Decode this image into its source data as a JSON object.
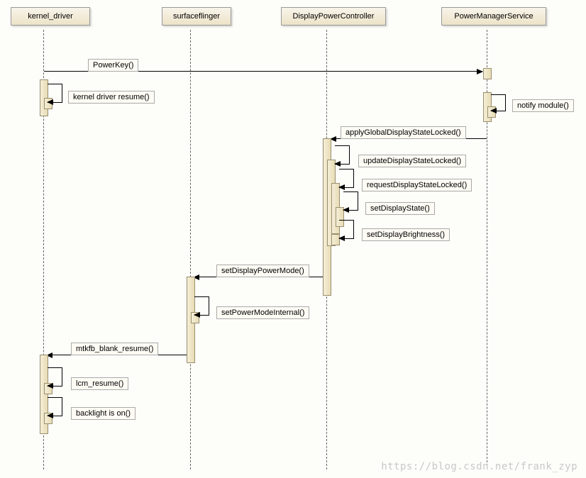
{
  "participants": {
    "p1": "kernel_driver",
    "p2": "surfaceflinger",
    "p3": "DisplayPowerController",
    "p4": "PowerManagerService"
  },
  "messages": {
    "m_powerkey": "PowerKey()",
    "m_kernel_resume": "kernel driver resume()",
    "m_notify": "notify module()",
    "m_applyGlobal": "applyGlobalDisplayStateLocked()",
    "m_updateDSL": "updateDisplayStateLocked()",
    "m_requestDSL": "requestDisplayStateLocked()",
    "m_setDS": "setDisplayState()",
    "m_setDB": "setDisplayBrightness()",
    "m_setDPM": "setDisplayPowerMode()",
    "m_setPMI": "setPowerModeInternal()",
    "m_mtkfb": "mtkfb_blank_resume()",
    "m_lcm": "lcm_resume()",
    "m_backlight": "backlight is on()"
  },
  "watermark": "https://blog.csdn.net/frank_zyp"
}
